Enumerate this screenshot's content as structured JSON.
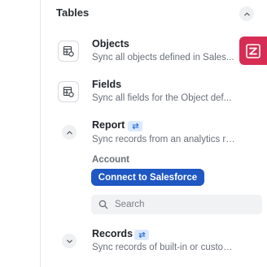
{
  "section": {
    "title": "Tables",
    "collapse_icon": "chevron-up-icon"
  },
  "rows": [
    {
      "title": "Objects",
      "description": "Sync all objects defined in Sales...",
      "icon": "table-sync-icon"
    },
    {
      "title": "Fields",
      "description": "Sync all fields for the Object def...",
      "icon": "table-sync-icon"
    },
    {
      "title": "Report",
      "description": "Sync records from an analytics re...",
      "icon": "chevron-up-icon",
      "badge_icon": "sync-arrows-icon"
    },
    {
      "title": "Records",
      "description": "Sync records of built-in or custom...",
      "icon": "chevron-down-icon",
      "badge_icon": "sync-arrows-icon"
    }
  ],
  "report_config": {
    "field_label": "Account",
    "connect_button": "Connect to Salesforce",
    "search": {
      "placeholder": "Search",
      "value": ""
    }
  },
  "side_app": {
    "icon": "zapier-z-icon",
    "color": "#d72d54"
  },
  "colors": {
    "accent": "#1f57c3",
    "badge_bg": "#dbe9ff"
  }
}
